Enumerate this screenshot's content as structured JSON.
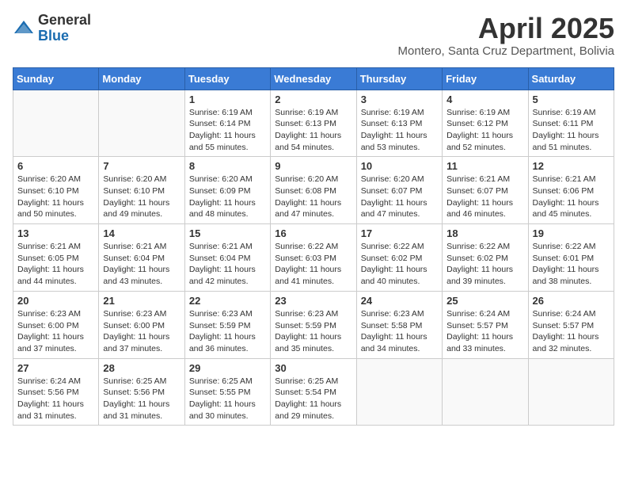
{
  "header": {
    "logo_general": "General",
    "logo_blue": "Blue",
    "month_title": "April 2025",
    "location": "Montero, Santa Cruz Department, Bolivia"
  },
  "weekdays": [
    "Sunday",
    "Monday",
    "Tuesday",
    "Wednesday",
    "Thursday",
    "Friday",
    "Saturday"
  ],
  "weeks": [
    [
      {
        "day": "",
        "empty": true
      },
      {
        "day": "",
        "empty": true
      },
      {
        "day": "1",
        "sunrise": "Sunrise: 6:19 AM",
        "sunset": "Sunset: 6:14 PM",
        "daylight": "Daylight: 11 hours and 55 minutes."
      },
      {
        "day": "2",
        "sunrise": "Sunrise: 6:19 AM",
        "sunset": "Sunset: 6:13 PM",
        "daylight": "Daylight: 11 hours and 54 minutes."
      },
      {
        "day": "3",
        "sunrise": "Sunrise: 6:19 AM",
        "sunset": "Sunset: 6:13 PM",
        "daylight": "Daylight: 11 hours and 53 minutes."
      },
      {
        "day": "4",
        "sunrise": "Sunrise: 6:19 AM",
        "sunset": "Sunset: 6:12 PM",
        "daylight": "Daylight: 11 hours and 52 minutes."
      },
      {
        "day": "5",
        "sunrise": "Sunrise: 6:19 AM",
        "sunset": "Sunset: 6:11 PM",
        "daylight": "Daylight: 11 hours and 51 minutes."
      }
    ],
    [
      {
        "day": "6",
        "sunrise": "Sunrise: 6:20 AM",
        "sunset": "Sunset: 6:10 PM",
        "daylight": "Daylight: 11 hours and 50 minutes."
      },
      {
        "day": "7",
        "sunrise": "Sunrise: 6:20 AM",
        "sunset": "Sunset: 6:10 PM",
        "daylight": "Daylight: 11 hours and 49 minutes."
      },
      {
        "day": "8",
        "sunrise": "Sunrise: 6:20 AM",
        "sunset": "Sunset: 6:09 PM",
        "daylight": "Daylight: 11 hours and 48 minutes."
      },
      {
        "day": "9",
        "sunrise": "Sunrise: 6:20 AM",
        "sunset": "Sunset: 6:08 PM",
        "daylight": "Daylight: 11 hours and 47 minutes."
      },
      {
        "day": "10",
        "sunrise": "Sunrise: 6:20 AM",
        "sunset": "Sunset: 6:07 PM",
        "daylight": "Daylight: 11 hours and 47 minutes."
      },
      {
        "day": "11",
        "sunrise": "Sunrise: 6:21 AM",
        "sunset": "Sunset: 6:07 PM",
        "daylight": "Daylight: 11 hours and 46 minutes."
      },
      {
        "day": "12",
        "sunrise": "Sunrise: 6:21 AM",
        "sunset": "Sunset: 6:06 PM",
        "daylight": "Daylight: 11 hours and 45 minutes."
      }
    ],
    [
      {
        "day": "13",
        "sunrise": "Sunrise: 6:21 AM",
        "sunset": "Sunset: 6:05 PM",
        "daylight": "Daylight: 11 hours and 44 minutes."
      },
      {
        "day": "14",
        "sunrise": "Sunrise: 6:21 AM",
        "sunset": "Sunset: 6:04 PM",
        "daylight": "Daylight: 11 hours and 43 minutes."
      },
      {
        "day": "15",
        "sunrise": "Sunrise: 6:21 AM",
        "sunset": "Sunset: 6:04 PM",
        "daylight": "Daylight: 11 hours and 42 minutes."
      },
      {
        "day": "16",
        "sunrise": "Sunrise: 6:22 AM",
        "sunset": "Sunset: 6:03 PM",
        "daylight": "Daylight: 11 hours and 41 minutes."
      },
      {
        "day": "17",
        "sunrise": "Sunrise: 6:22 AM",
        "sunset": "Sunset: 6:02 PM",
        "daylight": "Daylight: 11 hours and 40 minutes."
      },
      {
        "day": "18",
        "sunrise": "Sunrise: 6:22 AM",
        "sunset": "Sunset: 6:02 PM",
        "daylight": "Daylight: 11 hours and 39 minutes."
      },
      {
        "day": "19",
        "sunrise": "Sunrise: 6:22 AM",
        "sunset": "Sunset: 6:01 PM",
        "daylight": "Daylight: 11 hours and 38 minutes."
      }
    ],
    [
      {
        "day": "20",
        "sunrise": "Sunrise: 6:23 AM",
        "sunset": "Sunset: 6:00 PM",
        "daylight": "Daylight: 11 hours and 37 minutes."
      },
      {
        "day": "21",
        "sunrise": "Sunrise: 6:23 AM",
        "sunset": "Sunset: 6:00 PM",
        "daylight": "Daylight: 11 hours and 37 minutes."
      },
      {
        "day": "22",
        "sunrise": "Sunrise: 6:23 AM",
        "sunset": "Sunset: 5:59 PM",
        "daylight": "Daylight: 11 hours and 36 minutes."
      },
      {
        "day": "23",
        "sunrise": "Sunrise: 6:23 AM",
        "sunset": "Sunset: 5:59 PM",
        "daylight": "Daylight: 11 hours and 35 minutes."
      },
      {
        "day": "24",
        "sunrise": "Sunrise: 6:23 AM",
        "sunset": "Sunset: 5:58 PM",
        "daylight": "Daylight: 11 hours and 34 minutes."
      },
      {
        "day": "25",
        "sunrise": "Sunrise: 6:24 AM",
        "sunset": "Sunset: 5:57 PM",
        "daylight": "Daylight: 11 hours and 33 minutes."
      },
      {
        "day": "26",
        "sunrise": "Sunrise: 6:24 AM",
        "sunset": "Sunset: 5:57 PM",
        "daylight": "Daylight: 11 hours and 32 minutes."
      }
    ],
    [
      {
        "day": "27",
        "sunrise": "Sunrise: 6:24 AM",
        "sunset": "Sunset: 5:56 PM",
        "daylight": "Daylight: 11 hours and 31 minutes."
      },
      {
        "day": "28",
        "sunrise": "Sunrise: 6:25 AM",
        "sunset": "Sunset: 5:56 PM",
        "daylight": "Daylight: 11 hours and 31 minutes."
      },
      {
        "day": "29",
        "sunrise": "Sunrise: 6:25 AM",
        "sunset": "Sunset: 5:55 PM",
        "daylight": "Daylight: 11 hours and 30 minutes."
      },
      {
        "day": "30",
        "sunrise": "Sunrise: 6:25 AM",
        "sunset": "Sunset: 5:54 PM",
        "daylight": "Daylight: 11 hours and 29 minutes."
      },
      {
        "day": "",
        "empty": true
      },
      {
        "day": "",
        "empty": true
      },
      {
        "day": "",
        "empty": true
      }
    ]
  ]
}
